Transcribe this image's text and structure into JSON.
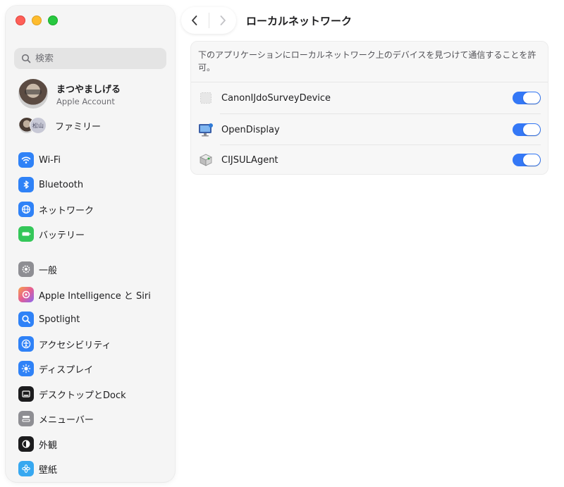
{
  "window": {
    "title": "ローカルネットワーク",
    "description": "下のアプリケーションにローカルネットワーク上のデバイスを見つけて通信することを許可。"
  },
  "sidebar": {
    "search_placeholder": "検索",
    "account": {
      "name": "まつやましげる",
      "subtitle": "Apple Account"
    },
    "family": {
      "label": "ファミリー",
      "member_initials": "松山"
    },
    "items": [
      {
        "label": "Wi-Fi",
        "icon": "wifi-icon",
        "color": "#2f82f7"
      },
      {
        "label": "Bluetooth",
        "icon": "bluetooth-icon",
        "color": "#2f82f7"
      },
      {
        "label": "ネットワーク",
        "icon": "globe-icon",
        "color": "#2f82f7"
      },
      {
        "label": "バッテリー",
        "icon": "battery-icon",
        "color": "#34c759"
      },
      {
        "label": "一般",
        "icon": "gear-icon",
        "color": "#8e8e93"
      },
      {
        "label": "Apple Intelligence と Siri",
        "icon": "siri-icon",
        "color": "#e86a8a"
      },
      {
        "label": "Spotlight",
        "icon": "magnifier-icon",
        "color": "#2f82f7"
      },
      {
        "label": "アクセシビリティ",
        "icon": "accessibility-icon",
        "color": "#2f82f7"
      },
      {
        "label": "ディスプレイ",
        "icon": "sun-icon",
        "color": "#2f82f7"
      },
      {
        "label": "デスクトップとDock",
        "icon": "dock-icon",
        "color": "#1c1c1e"
      },
      {
        "label": "メニューバー",
        "icon": "menubar-icon",
        "color": "#8e8e93"
      },
      {
        "label": "外観",
        "icon": "appearance-icon",
        "color": "#1c1c1e"
      },
      {
        "label": "壁紙",
        "icon": "wallpaper-icon",
        "color": "#37a8f0"
      }
    ]
  },
  "apps": [
    {
      "name": "CanonIJdoSurveyDevice",
      "enabled": true,
      "icon": "generic-app-icon"
    },
    {
      "name": "OpenDisplay",
      "enabled": true,
      "icon": "display-app-icon"
    },
    {
      "name": "CIJSULAgent",
      "enabled": true,
      "icon": "agent-app-icon"
    }
  ],
  "colors": {
    "accent": "#3478f6",
    "close": "#fe5f57",
    "minimize": "#febc2e",
    "zoom": "#28c840"
  }
}
